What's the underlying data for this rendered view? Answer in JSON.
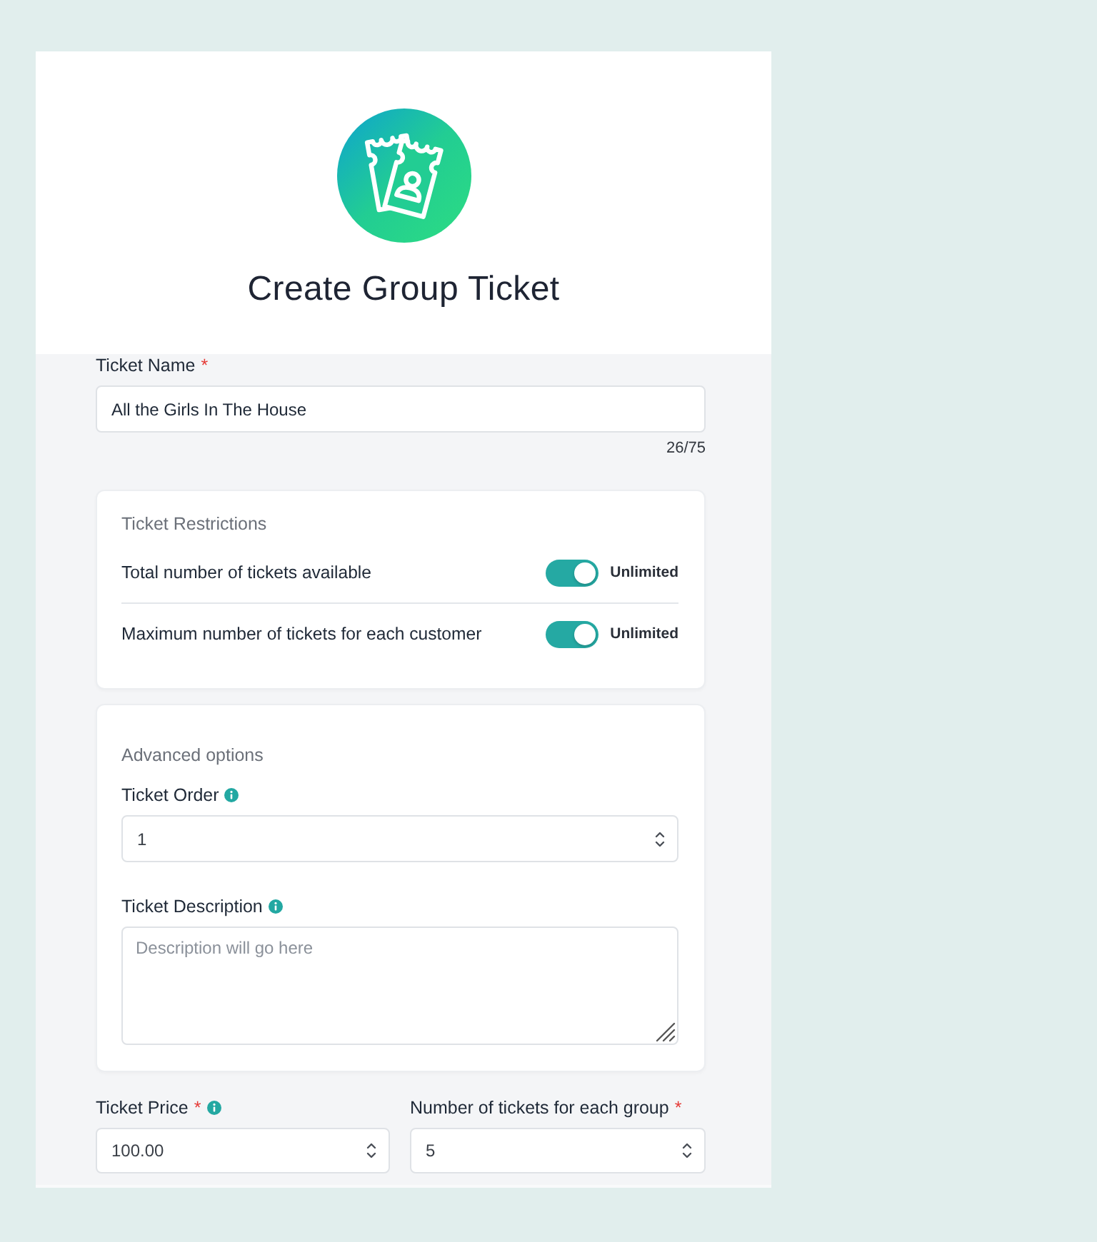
{
  "header": {
    "title": "Create Group Ticket"
  },
  "ticket_name": {
    "kind": "text",
    "label": "Ticket Name",
    "required_mark": "*",
    "value": "All the Girls In The House",
    "counter": "26/75"
  },
  "restrictions": {
    "title": "Ticket Restrictions",
    "rows": [
      {
        "label": "Total number of tickets available",
        "on": true,
        "status": "Unlimited"
      },
      {
        "label": "Maximum number of tickets for each customer",
        "on": true,
        "status": "Unlimited"
      }
    ]
  },
  "advanced": {
    "title": "Advanced options",
    "fields": [
      {
        "kind": "number",
        "label": "Ticket Order",
        "info": true,
        "value": "1"
      },
      {
        "kind": "textarea",
        "label": "Ticket Description",
        "info": true,
        "placeholder": "Description will go here"
      }
    ]
  },
  "pricing": {
    "fields": [
      {
        "kind": "number",
        "label": "Ticket Price",
        "required_mark": "*",
        "info": true,
        "value": "100.00"
      },
      {
        "kind": "number",
        "label": "Number of tickets for each group",
        "required_mark": "*",
        "info": false,
        "value": "5"
      }
    ]
  }
}
